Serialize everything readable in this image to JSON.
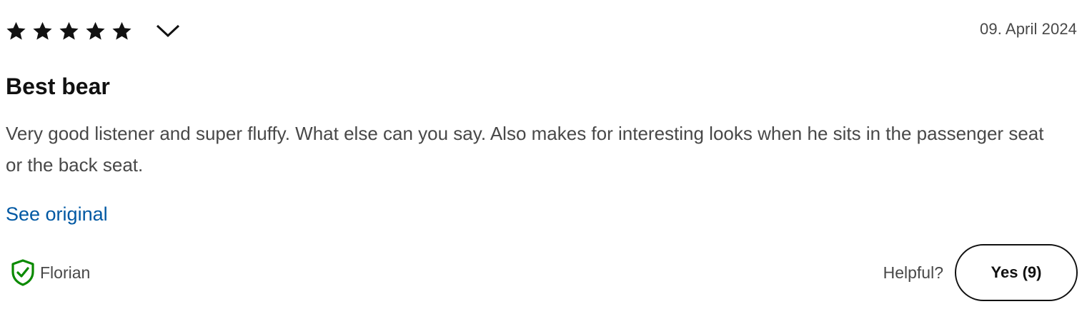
{
  "review": {
    "rating": 5,
    "rating_max": 5,
    "date": "09. April 2024",
    "title": "Best bear",
    "body": "Very good listener and super fluffy. What else can you say. Also makes for interesting looks when he sits in the passenger seat or the back seat.",
    "see_original_label": "See original",
    "reviewer_name": "Florian",
    "helpful_label": "Helpful?",
    "yes_button_label": "Yes (9)"
  },
  "icons": {
    "star": "star-icon",
    "expand": "chevron-down-icon",
    "verified": "verified-shield-icon"
  },
  "colors": {
    "star": "#111111",
    "link": "#0058a3",
    "verified": "#0a8a00",
    "text_secondary": "#484848"
  }
}
